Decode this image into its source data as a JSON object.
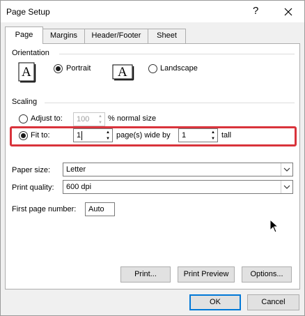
{
  "window": {
    "title": "Page Setup",
    "help_glyph": "?"
  },
  "tabs": [
    {
      "label": "Page",
      "active": true
    },
    {
      "label": "Margins",
      "active": false
    },
    {
      "label": "Header/Footer",
      "active": false
    },
    {
      "label": "Sheet",
      "active": false
    }
  ],
  "orientation": {
    "label": "Orientation",
    "page_glyph": "A",
    "portrait": {
      "label": "Portrait",
      "selected": true
    },
    "landscape": {
      "label": "Landscape",
      "selected": false
    }
  },
  "scaling": {
    "label": "Scaling",
    "adjust_to": {
      "label": "Adjust to:",
      "value": "100",
      "suffix": "% normal size",
      "selected": false,
      "enabled": false
    },
    "fit_to": {
      "label": "Fit to:",
      "selected": true,
      "pages_wide": "1",
      "wide_label": "page(s) wide by",
      "pages_tall": "1",
      "tall_label": "tall"
    },
    "highlight_color": "#d9333b"
  },
  "paper_size": {
    "label": "Paper size:",
    "value": "Letter"
  },
  "print_quality": {
    "label": "Print quality:",
    "value": "600 dpi"
  },
  "first_page_number": {
    "label": "First page number:",
    "value": "Auto"
  },
  "buttons": {
    "print": "Print...",
    "print_preview": "Print Preview",
    "options": "Options...",
    "ok": "OK",
    "cancel": "Cancel"
  },
  "accent_color": "#0078d7"
}
